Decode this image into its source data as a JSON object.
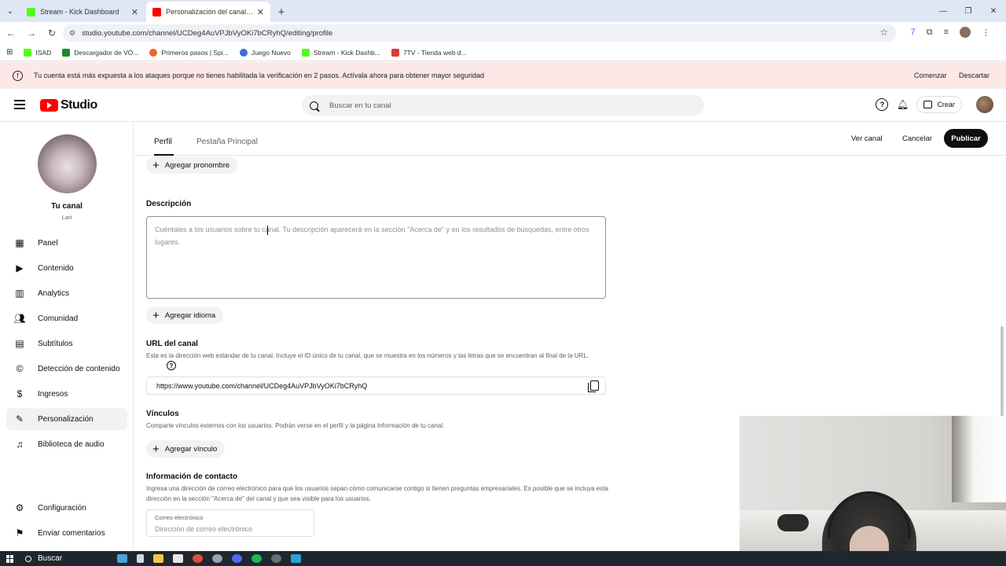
{
  "browser": {
    "tabs": [
      {
        "title": "Stream - Kick Dashboard",
        "active": false,
        "favicon_color": "#53fc18"
      },
      {
        "title": "Personalización del canal - You",
        "active": true,
        "favicon_color": "#ff0000"
      }
    ],
    "url": "studio.youtube.com/channel/UCDeg4AuVPJbVyOKi7bCRyhQ/editing/profile",
    "bookmarks": [
      {
        "label": "ISAD",
        "color": "#53fc18"
      },
      {
        "label": "Descargador de VÓ...",
        "color": "#1b8a2a"
      },
      {
        "label": "Primeros pasos | Spi...",
        "color": "#e8642c"
      },
      {
        "label": "Juego Nuevo",
        "color": "#3b6fd8"
      },
      {
        "label": "Stream - Kick Dashb...",
        "color": "#53fc18"
      },
      {
        "label": "7TV - Tienda web d...",
        "color": "#d93b3b"
      }
    ]
  },
  "banner": {
    "message": "Tu cuenta está más expuesta a los ataques porque no tienes habilitada la verificación en 2 pasos. Actívala ahora para obtener mayor seguridad",
    "start_label": "Comenzar",
    "dismiss_label": "Descartar",
    "color": "#fce8e6"
  },
  "header": {
    "logo_text": "Studio",
    "search_placeholder": "Buscar en tu canal",
    "create_label": "Crear"
  },
  "sidebar": {
    "channel_title": "Tu canal",
    "channel_name": "Lari",
    "items": [
      {
        "label": "Panel",
        "icon": "dashboard-icon",
        "active": false
      },
      {
        "label": "Contenido",
        "icon": "content-icon",
        "active": false
      },
      {
        "label": "Analytics",
        "icon": "analytics-icon",
        "active": false
      },
      {
        "label": "Comunidad",
        "icon": "community-icon",
        "active": false
      },
      {
        "label": "Subtítulos",
        "icon": "subtitles-icon",
        "active": false
      },
      {
        "label": "Detección de contenido",
        "icon": "copyright-icon",
        "active": false
      },
      {
        "label": "Ingresos",
        "icon": "earn-icon",
        "active": false
      },
      {
        "label": "Personalización",
        "icon": "customization-icon",
        "active": true
      },
      {
        "label": "Biblioteca de audio",
        "icon": "audio-library-icon",
        "active": false
      }
    ],
    "footer_items": [
      {
        "label": "Configuración",
        "icon": "settings-icon"
      },
      {
        "label": "Enviar comentarios",
        "icon": "feedback-icon"
      }
    ]
  },
  "main": {
    "tabs": [
      {
        "label": "Perfil",
        "active": true
      },
      {
        "label": "Pestaña Principal",
        "active": false
      }
    ],
    "actions": {
      "view_channel": "Ver canal",
      "cancel": "Cancelar",
      "publish": "Publicar"
    },
    "add_pronoun": "Agregar pronombre",
    "description": {
      "title": "Descripción",
      "placeholder": "Cuéntales a los usuarios sobre tu canal. Tu descripción aparecerá en la sección \"Acerca de\" y en los resultados de búsquedas, entre otros lugares."
    },
    "add_language": "Agregar idioma",
    "channel_url": {
      "title": "URL del canal",
      "desc": "Esta es la dirección web estándar de tu canal. Incluye el ID único de tu canal, que se muestra en los números y las letras que se encuentran al final de la URL.",
      "value": "https://www.youtube.com/channel/UCDeg4AuVPJbVyOKi7bCRyhQ"
    },
    "links": {
      "title": "Vínculos",
      "desc": "Comparte vínculos externos con los usuarios. Podrán verse en el perfil y la página Información de tu canal.",
      "add_label": "Agregar vínculo"
    },
    "contact": {
      "title": "Información de contacto",
      "desc": "Ingresa una dirección de correo electrónico para que los usuarios sepan cómo comunicarse contigo si tienen preguntas empresariales. Es posible que se incluya esta dirección en la sección \"Acerca de\" del canal y que sea visible para los usuarios.",
      "email_label": "Correo electrónico",
      "email_placeholder": "Dirección de correo electrónico"
    }
  },
  "taskbar": {
    "search_label": "Buscar"
  }
}
